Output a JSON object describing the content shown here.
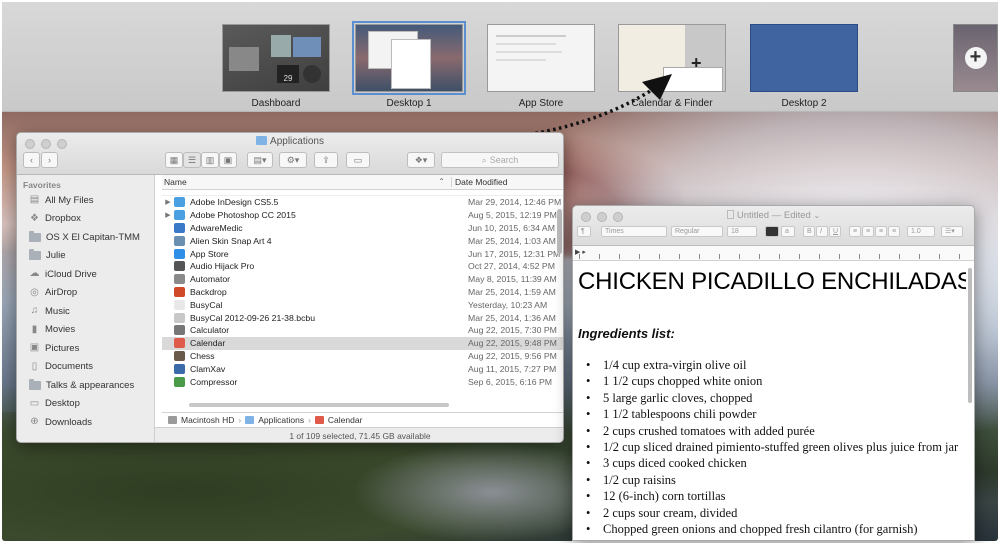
{
  "mission_control": {
    "spaces": [
      {
        "label": "Dashboard",
        "badge": "29"
      },
      {
        "label": "Desktop 1"
      },
      {
        "label": "App Store"
      },
      {
        "label": "Calendar & Finder"
      },
      {
        "label": "Desktop 2"
      }
    ],
    "add_space_icon": "plus-icon"
  },
  "finder": {
    "title": "Applications",
    "search_placeholder": "Search",
    "sidebar": {
      "heading": "Favorites",
      "items": [
        {
          "label": "All My Files",
          "icon": "all-files-icon"
        },
        {
          "label": "Dropbox",
          "icon": "dropbox-icon"
        },
        {
          "label": "OS X El Capitan-TMM",
          "icon": "folder-icon"
        },
        {
          "label": "Julie",
          "icon": "folder-icon"
        },
        {
          "label": "iCloud Drive",
          "icon": "cloud-icon"
        },
        {
          "label": "AirDrop",
          "icon": "airdrop-icon"
        },
        {
          "label": "Music",
          "icon": "music-icon"
        },
        {
          "label": "Movies",
          "icon": "movies-icon"
        },
        {
          "label": "Pictures",
          "icon": "pictures-icon"
        },
        {
          "label": "Documents",
          "icon": "documents-icon"
        },
        {
          "label": "Talks & appearances",
          "icon": "folder-icon"
        },
        {
          "label": "Desktop",
          "icon": "desktop-icon"
        },
        {
          "label": "Downloads",
          "icon": "downloads-icon"
        }
      ]
    },
    "columns": {
      "name": "Name",
      "date": "Date Modified"
    },
    "rows": [
      {
        "name": "Adobe InDesign CS5.5",
        "date": "Mar 29, 2014, 12:46 PM",
        "folder": true,
        "color": "#4aa0e0"
      },
      {
        "name": "Adobe Photoshop CC 2015",
        "date": "Aug 5, 2015, 12:19 PM",
        "folder": true,
        "color": "#4aa0e0"
      },
      {
        "name": "AdwareMedic",
        "date": "Jun 10, 2015, 6:34 AM",
        "folder": false,
        "color": "#3a78c8"
      },
      {
        "name": "Alien Skin Snap Art 4",
        "date": "Mar 25, 2014, 1:03 AM",
        "folder": false,
        "color": "#6a8fb0"
      },
      {
        "name": "App Store",
        "date": "Jun 17, 2015, 12:31 PM",
        "folder": false,
        "color": "#2f8fe8"
      },
      {
        "name": "Audio Hijack Pro",
        "date": "Oct 27, 2014, 4:52 PM",
        "folder": false,
        "color": "#555555"
      },
      {
        "name": "Automator",
        "date": "May 8, 2015, 11:39 AM",
        "folder": false,
        "color": "#8a8a8a"
      },
      {
        "name": "Backdrop",
        "date": "Mar 25, 2014, 1:59 AM",
        "folder": false,
        "color": "#d04a2a"
      },
      {
        "name": "BusyCal",
        "date": "Yesterday, 10:23 AM",
        "folder": false,
        "color": "#e8e8e8"
      },
      {
        "name": "BusyCal 2012-09-26 21-38.bcbu",
        "date": "Mar 25, 2014, 1:36 AM",
        "folder": false,
        "color": "#c8c8c8"
      },
      {
        "name": "Calculator",
        "date": "Aug 22, 2015, 7:30 PM",
        "folder": false,
        "color": "#777777"
      },
      {
        "name": "Calendar",
        "date": "Aug 22, 2015, 9:48 PM",
        "folder": false,
        "color": "#e05a4a",
        "selected": true
      },
      {
        "name": "Chess",
        "date": "Aug 22, 2015, 9:56 PM",
        "folder": false,
        "color": "#6a5a4a"
      },
      {
        "name": "ClamXav",
        "date": "Aug 11, 2015, 7:27 PM",
        "folder": false,
        "color": "#3a6aa8"
      },
      {
        "name": "Compressor",
        "date": "Sep 6, 2015, 6:16 PM",
        "folder": false,
        "color": "#4a9a4a"
      }
    ],
    "path": [
      "Macintosh HD",
      "Applications",
      "Calendar"
    ],
    "status": "1 of 109 selected, 71.45 GB available"
  },
  "textedit": {
    "title": "Untitled",
    "title_suffix": "— Edited",
    "toolbar": {
      "font": "Times",
      "style": "Regular",
      "size": "18",
      "spacing": "1.0"
    },
    "heading": "CHICKEN PICADILLO ENCHILADAS",
    "subheading": "Ingredients list:",
    "ingredients": [
      "1/4 cup extra-virgin olive oil",
      "1 1/2 cups chopped white onion",
      "5 large garlic cloves, chopped",
      "1 1/2 tablespoons chili powder",
      "2 cups crushed tomatoes with added purée",
      "1/2 cup sliced drained pimiento-stuffed green olives plus juice from jar",
      "3 cups diced cooked chicken",
      "1/2 cup raisins",
      "12 (6-inch) corn tortillas",
      "2 cups sour cream, divided",
      "Chopped green onions and chopped fresh cilantro (for garnish)"
    ]
  }
}
